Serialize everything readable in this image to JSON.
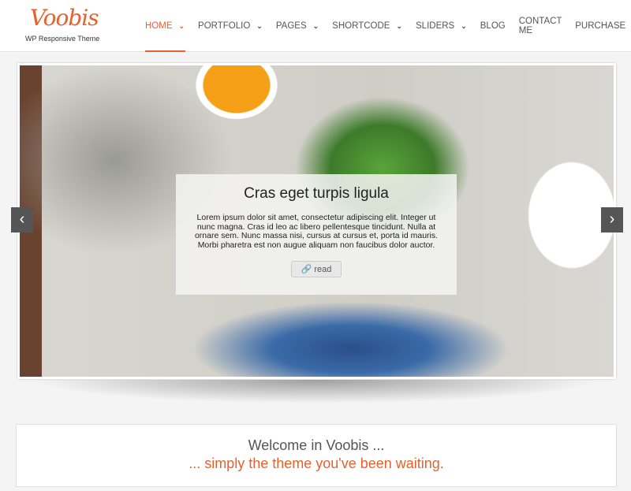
{
  "header": {
    "logo": "Voobis",
    "tagline": "WP Responsive Theme"
  },
  "nav": [
    {
      "label": "HOME",
      "dropdown": true,
      "active": true
    },
    {
      "label": "PORTFOLIO",
      "dropdown": true
    },
    {
      "label": "PAGES",
      "dropdown": true
    },
    {
      "label": "SHORTCODE",
      "dropdown": true
    },
    {
      "label": "SLIDERS",
      "dropdown": true
    },
    {
      "label": "BLOG"
    },
    {
      "label": "CONTACT ME"
    },
    {
      "label": "PURCHASE"
    }
  ],
  "slider": {
    "title": "Cras eget turpis ligula",
    "text": "Lorem ipsum dolor sit amet, consectetur adipiscing elit. Integer ut nunc magna. Cras id leo ac libero pellentesque tincidunt. Nulla at ornare sem. Nunc massa nisi, cursus at cursus et, porta id mauris. Morbi pharetra est non augue aliquam non faucibus dolor auctor.",
    "button": "read",
    "button_icon": "link-icon",
    "prev": "‹",
    "next": "›"
  },
  "welcome": {
    "line1": "Welcome in Voobis ...",
    "line2": "... simply the theme you've been waiting."
  },
  "colors": {
    "accent": "#e8602c"
  }
}
